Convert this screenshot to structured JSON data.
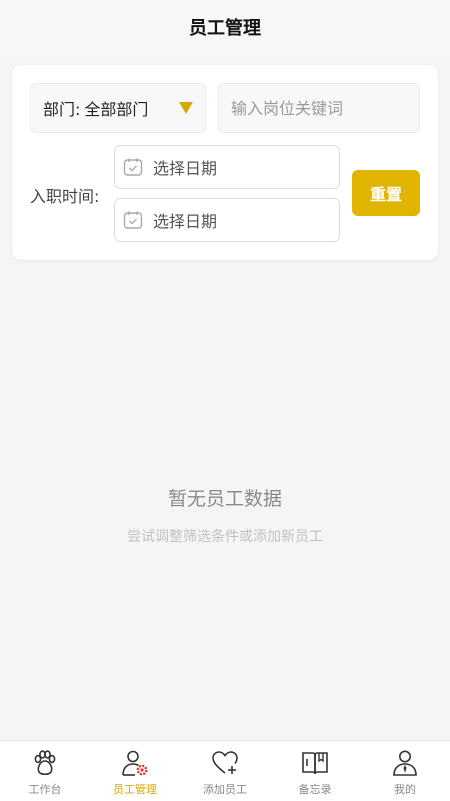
{
  "header": {
    "title": "员工管理"
  },
  "filters": {
    "department_label": "部门:",
    "department_value": "全部部门",
    "keyword_placeholder": "输入岗位关键词",
    "join_time_label": "入职时间:",
    "start_date_placeholder": "选择日期",
    "end_date_placeholder": "选择日期",
    "reset_label": "重置"
  },
  "empty_state": {
    "title": "暂无员工数据",
    "subtitle": "尝试调整筛选条件或添加新员工"
  },
  "tabbar": {
    "active": "tab-employee-management",
    "items": [
      {
        "label": "工作台",
        "icon": "paw-icon"
      },
      {
        "label": "员工管理",
        "icon": "user-gear-icon"
      },
      {
        "label": "添加员工",
        "icon": "heart-plus-icon"
      },
      {
        "label": "备忘录",
        "icon": "book-icon"
      },
      {
        "label": "我的",
        "icon": "person-icon"
      }
    ]
  },
  "colors": {
    "accent": "#e0b400",
    "active_tab": "#d9a900",
    "background": "#f5f5f5"
  }
}
